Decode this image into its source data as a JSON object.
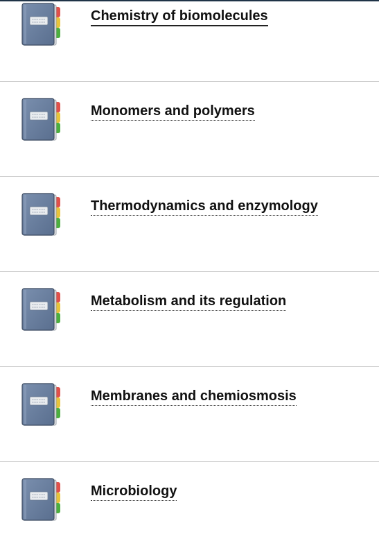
{
  "topics": [
    {
      "title": "Chemistry of biomolecules",
      "icon": "notebook-icon",
      "current": true
    },
    {
      "title": "Monomers and polymers",
      "icon": "notebook-icon",
      "current": false
    },
    {
      "title": "Thermodynamics and enzymology",
      "icon": "notebook-icon",
      "current": false
    },
    {
      "title": "Metabolism and its regulation",
      "icon": "notebook-icon",
      "current": false
    },
    {
      "title": "Membranes and chemiosmosis",
      "icon": "notebook-icon",
      "current": false
    },
    {
      "title": "Microbiology",
      "icon": "notebook-icon",
      "current": false
    }
  ],
  "colors": {
    "top_rule": "#1f3347",
    "notebook_cover": "#5a6f8f",
    "tab_red": "#e0504a",
    "tab_yellow": "#e8c43a",
    "tab_green": "#4caf3e",
    "divider": "#cfcfcf"
  }
}
